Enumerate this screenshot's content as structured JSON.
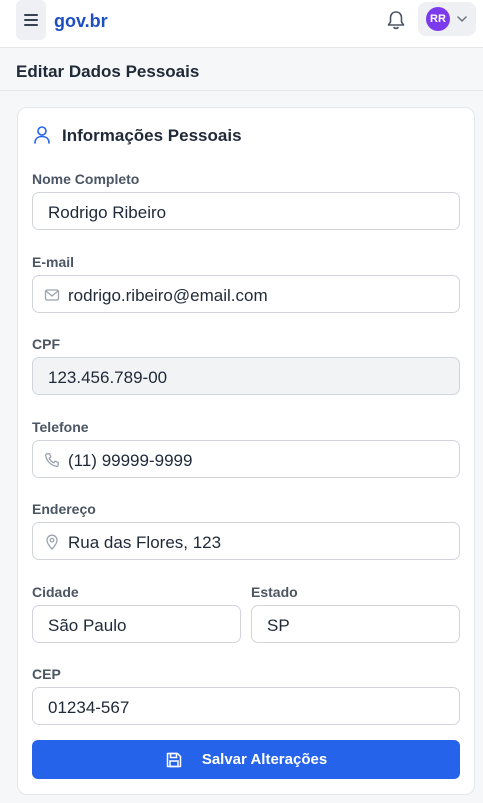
{
  "header": {
    "logo": "gov.br",
    "menu_icon": "menu-icon",
    "notification_icon": "bell-icon",
    "avatar_initials": "RR",
    "dropdown_icon": "chevron-down-icon"
  },
  "page": {
    "title": "Editar Dados Pessoais"
  },
  "section": {
    "title": "Informações Pessoais",
    "icon": "user-icon"
  },
  "form": {
    "nome": {
      "label": "Nome Completo",
      "value": "Rodrigo Ribeiro"
    },
    "email": {
      "label": "E-mail",
      "value": "rodrigo.ribeiro@email.com",
      "icon": "mail-icon"
    },
    "cpf": {
      "label": "CPF",
      "value": "123.456.789-00",
      "disabled": true
    },
    "telefone": {
      "label": "Telefone",
      "value": "(11) 99999-9999",
      "icon": "phone-icon"
    },
    "endereco": {
      "label": "Endereço",
      "value": "Rua das Flores, 123",
      "icon": "map-pin-icon"
    },
    "cidade": {
      "label": "Cidade",
      "value": "São Paulo"
    },
    "estado": {
      "label": "Estado",
      "value": "SP"
    },
    "cep": {
      "label": "CEP",
      "value": "01234-567"
    }
  },
  "actions": {
    "save_label": "Salvar Alterações",
    "save_icon": "save-icon"
  },
  "colors": {
    "brand": "#1d4fbf",
    "primary_button": "#2563eb",
    "avatar": "#7c3aed",
    "disabled_field": "#f1f3f5"
  }
}
